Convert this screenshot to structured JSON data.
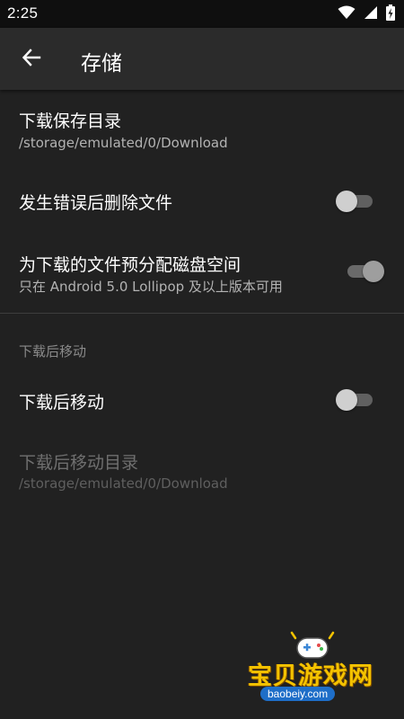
{
  "status_bar": {
    "time": "2:25",
    "icons": [
      "wifi-icon",
      "signal-icon",
      "battery-charging-icon"
    ]
  },
  "app_bar": {
    "back_icon": "arrow-left-icon",
    "title": "存储"
  },
  "settings": {
    "download_dir": {
      "title": "下载保存目录",
      "summary": "/storage/emulated/0/Download"
    },
    "delete_on_error": {
      "title": "发生错误后删除文件",
      "enabled": false
    },
    "preallocate": {
      "title": "为下载的文件预分配磁盘空间",
      "summary": "只在 Android 5.0 Lollipop 及以上版本可用",
      "enabled": true,
      "disabled": true
    },
    "move_section": {
      "header": "下载后移动"
    },
    "move_after_download": {
      "title": "下载后移动",
      "enabled": false
    },
    "move_dir": {
      "title": "下载后移动目录",
      "summary": "/storage/emulated/0/Download",
      "disabled": true
    }
  },
  "watermark": {
    "text": "宝贝游戏网",
    "url": "baobeiy.com"
  },
  "colors": {
    "background": "#212121",
    "app_bar": "#2b2b2b",
    "status_bar": "#0f0f0f",
    "primary_text": "#ffffff",
    "secondary_text": "#b3b3b3",
    "disabled_text": "#6f6f6f",
    "watermark": "#f4c300"
  }
}
